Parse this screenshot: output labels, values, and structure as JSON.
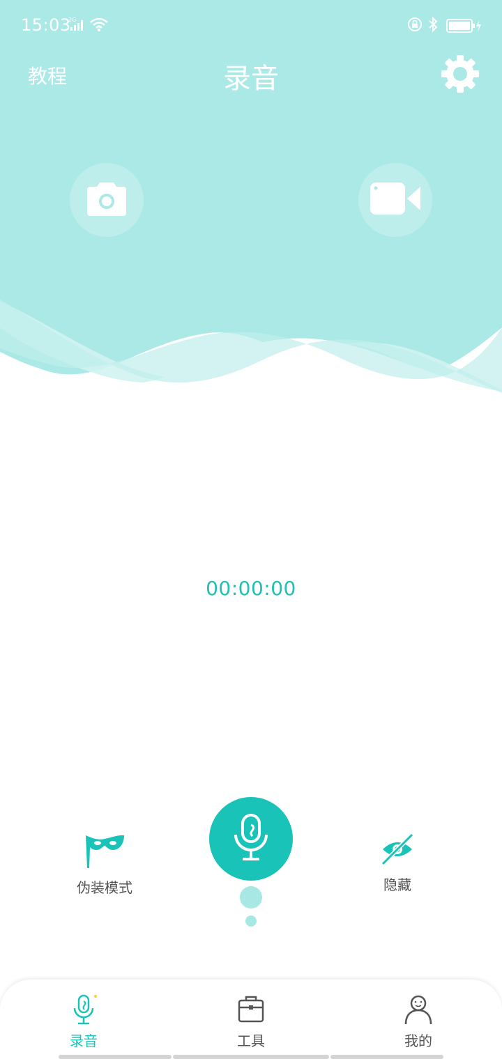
{
  "colors": {
    "accent": "#1ac3b8",
    "header_bg": "#abe9e6",
    "wave_light": "#d1f3f1",
    "dot": "#a7e8e4"
  },
  "status_bar": {
    "time": "15:03",
    "network": "2G",
    "icons": [
      "signal-icon",
      "wifi-icon",
      "lock-rotation-icon",
      "bluetooth-icon",
      "battery-charging-icon"
    ]
  },
  "nav": {
    "tutorial": "教程",
    "title": "录音",
    "settings_icon": "gear-icon"
  },
  "quick_actions": {
    "photo_icon": "camera-icon",
    "video_icon": "video-camera-icon"
  },
  "recorder": {
    "timer": "00:00:00",
    "disguise_label": "伪装模式",
    "hide_label": "隐藏",
    "record_icon": "microphone-icon"
  },
  "tab_bar": {
    "tabs": [
      {
        "label": "录音",
        "icon": "microphone-icon",
        "active": true
      },
      {
        "label": "工具",
        "icon": "toolbox-icon",
        "active": false
      },
      {
        "label": "我的",
        "icon": "user-icon",
        "active": false
      }
    ]
  }
}
